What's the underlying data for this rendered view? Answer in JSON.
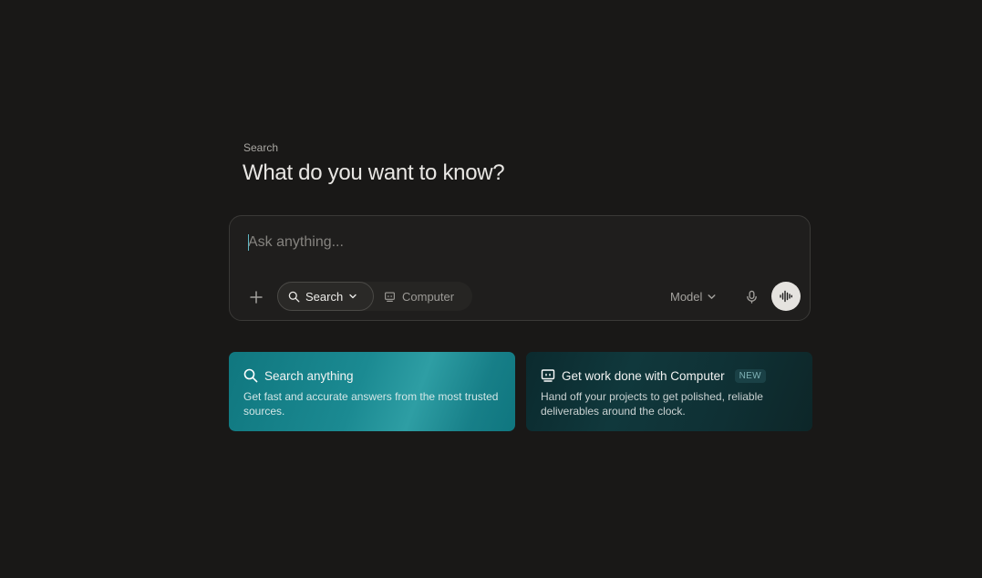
{
  "header": {
    "eyebrow": "Search",
    "headline": "What do you want to know?"
  },
  "composer": {
    "placeholder": "Ask anything...",
    "value": "",
    "modes": {
      "search_label": "Search",
      "computer_label": "Computer",
      "selected": "Search"
    },
    "model_label": "Model",
    "icons": {
      "attach": "plus-icon",
      "search": "search-icon",
      "computer": "computer-icon",
      "chevron": "chevron-down-icon",
      "mic": "microphone-icon",
      "voice": "audio-waveform-icon"
    }
  },
  "cards": [
    {
      "title": "Search anything",
      "description": "Get fast and accurate answers from the most trusted sources.",
      "icon": "search-icon",
      "badge": ""
    },
    {
      "title": "Get work done with Computer",
      "description": "Hand off your projects to get polished, reliable deliverables around the clock.",
      "icon": "computer-icon",
      "badge": "NEW"
    }
  ],
  "colors": {
    "background": "#191817",
    "accent_teal": "#1b8a92",
    "card_dark": "#10383c"
  }
}
